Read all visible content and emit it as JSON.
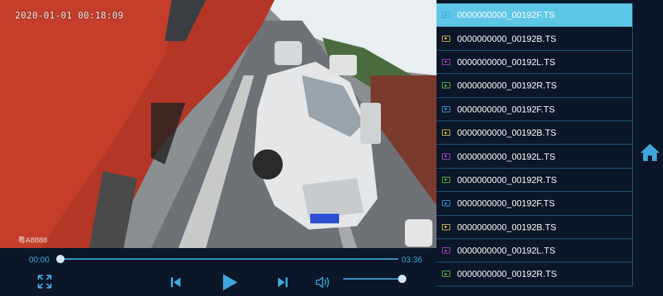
{
  "video": {
    "timestamp": "2020-01-01 00:18:09",
    "watermark": "粤A8888"
  },
  "player": {
    "current_time": "00:00",
    "duration": "03:36",
    "progress": 0,
    "volume": 1.0
  },
  "files": [
    {
      "name": "0000000000_00192F.TS",
      "color": "#3aa2e0",
      "selected": true
    },
    {
      "name": "0000000000_00192B.TS",
      "color": "#e3c64a"
    },
    {
      "name": "0000000000_00192L.TS",
      "color": "#b04ac9"
    },
    {
      "name": "0000000000_00192R.TS",
      "color": "#5bc244"
    },
    {
      "name": "0000000000_00192F.TS",
      "color": "#3aa2e0"
    },
    {
      "name": "0000000000_00192B.TS",
      "color": "#e3c64a"
    },
    {
      "name": "0000000000_00192L.TS",
      "color": "#b04ac9"
    },
    {
      "name": "0000000000_00192R.TS",
      "color": "#5bc244"
    },
    {
      "name": "0000000000_00192F.TS",
      "color": "#3aa2e0"
    },
    {
      "name": "0000000000_00192B.TS",
      "color": "#e3c64a"
    },
    {
      "name": "0000000000_00192L.TS",
      "color": "#b04ac9"
    },
    {
      "name": "0000000000_00192R.TS",
      "color": "#5bc244"
    }
  ],
  "icons": {
    "fullscreen": "fullscreen-icon",
    "previous": "skip-previous-icon",
    "play": "play-icon",
    "next": "skip-next-icon",
    "volume": "volume-icon",
    "home": "home-icon"
  },
  "colors": {
    "accent": "#3fa7dc",
    "selected_row": "#5ec7e6",
    "background": "#0b1628"
  }
}
